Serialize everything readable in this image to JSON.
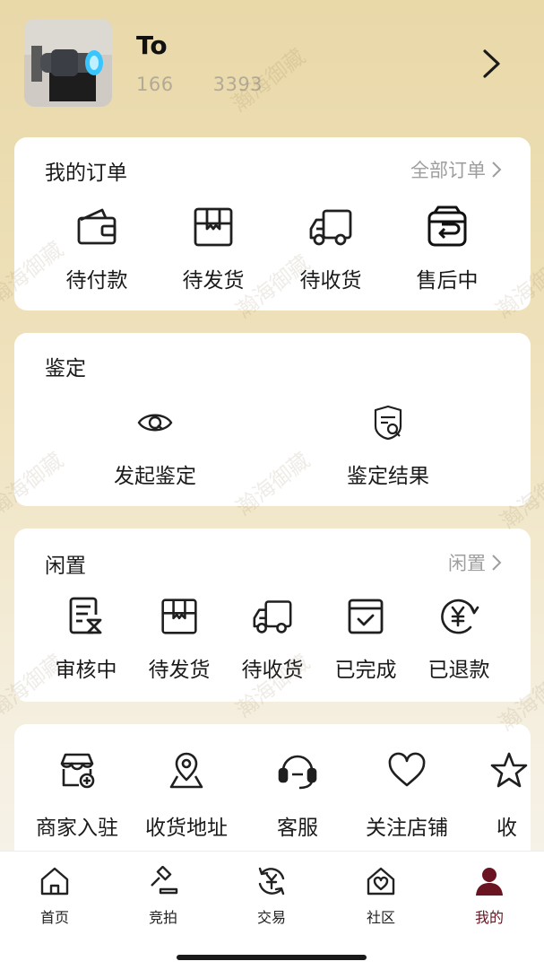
{
  "profile": {
    "name": "To",
    "phone_start": "166",
    "phone_end": "3393"
  },
  "orders": {
    "title": "我的订单",
    "all_link": "全部订单",
    "items": [
      {
        "label": "待付款",
        "icon": "wallet-icon"
      },
      {
        "label": "待发货",
        "icon": "package-icon"
      },
      {
        "label": "待收货",
        "icon": "truck-icon"
      },
      {
        "label": "售后中",
        "icon": "return-box-icon"
      }
    ]
  },
  "appraisal": {
    "title": "鉴定",
    "items": [
      {
        "label": "发起鉴定",
        "icon": "eye-icon"
      },
      {
        "label": "鉴定结果",
        "icon": "document-search-icon"
      }
    ]
  },
  "idle": {
    "title": "闲置",
    "link": "闲置",
    "items": [
      {
        "label": "审核中",
        "icon": "document-hourglass-icon"
      },
      {
        "label": "待发货",
        "icon": "package-icon"
      },
      {
        "label": "待收货",
        "icon": "truck-icon"
      },
      {
        "label": "已完成",
        "icon": "calendar-check-icon"
      },
      {
        "label": "已退款",
        "icon": "refund-yen-icon"
      }
    ]
  },
  "services": {
    "items": [
      {
        "label": "商家入驻",
        "icon": "store-add-icon"
      },
      {
        "label": "收货地址",
        "icon": "location-pin-icon"
      },
      {
        "label": "客服",
        "icon": "headset-icon"
      },
      {
        "label": "关注店铺",
        "icon": "heart-icon"
      },
      {
        "label": "收",
        "icon": "star-icon"
      }
    ]
  },
  "tabs": [
    {
      "label": "首页",
      "icon": "home-icon"
    },
    {
      "label": "竞拍",
      "icon": "gavel-icon"
    },
    {
      "label": "交易",
      "icon": "yen-exchange-icon"
    },
    {
      "label": "社区",
      "icon": "community-house-heart-icon"
    },
    {
      "label": "我的",
      "icon": "person-icon",
      "active": true
    }
  ],
  "watermark_text": "瀚海御藏",
  "colors": {
    "accent": "#6a1422",
    "header_gradient_top": "#e9d8a8",
    "muted_text": "#9e9e9e"
  }
}
